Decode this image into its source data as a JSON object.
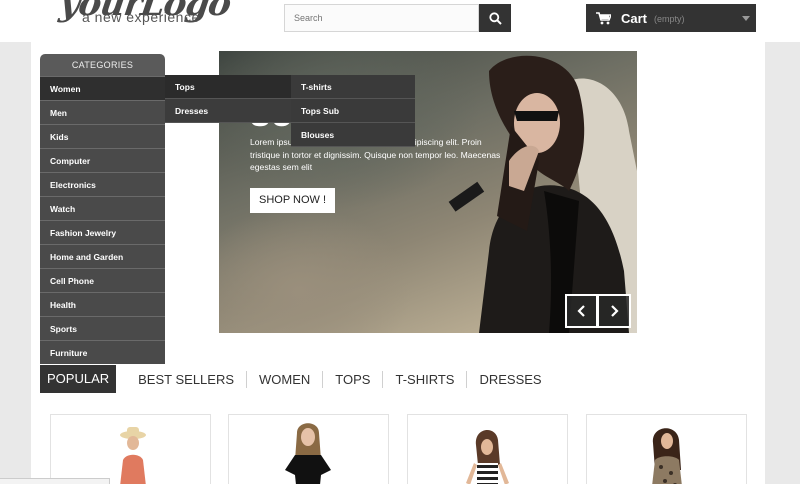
{
  "header": {
    "logo_script": "yourLogo",
    "logo_tagline": "a new experience",
    "search_placeholder": "Search",
    "cart_label": "Cart",
    "cart_status": "(empty)"
  },
  "categories": {
    "title": "CATEGORIES",
    "items": [
      "Women",
      "Men",
      "Kids",
      "Computer",
      "Electronics",
      "Watch",
      "Fashion Jewelry",
      "Home and Garden",
      "Cell Phone",
      "Health",
      "Sports",
      "Furniture"
    ]
  },
  "submenu": {
    "level1": [
      "Tops",
      "Dresses"
    ],
    "level2": [
      "T-shirts",
      "Tops Sub",
      "Blouses"
    ]
  },
  "banner": {
    "title": "SUM",
    "text": "Lorem ipsum dolor sit amet, consectetur adipiscing elit. Proin tristique in tortor et dignissim. Quisque non tempor leo. Maecenas egestas sem elit",
    "button": "SHOP NOW !"
  },
  "tabs": [
    "POPULAR",
    "BEST SELLERS",
    "WOMEN",
    "TOPS",
    "T-SHIRTS",
    "DRESSES"
  ],
  "colors": {
    "dark": "#333333",
    "menu": "#4a4a4a",
    "background": "#e9e9e9"
  }
}
